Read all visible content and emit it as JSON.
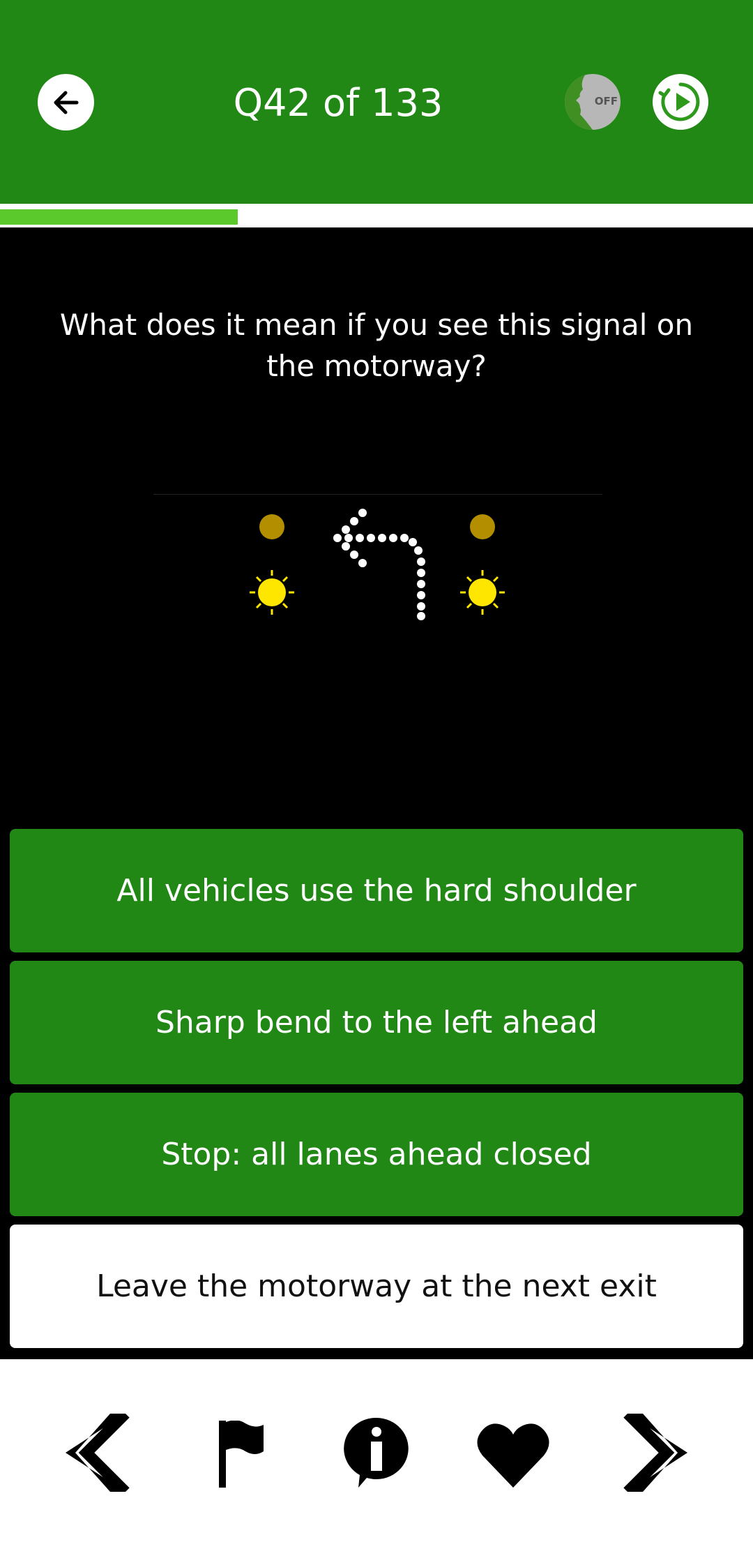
{
  "header": {
    "title": "Q42 of 133",
    "voice_state": "OFF",
    "icons": {
      "back": "arrow-left-icon",
      "voice": "voice-toggle-icon",
      "replay": "replay-icon"
    }
  },
  "progress": {
    "fraction": 0.3158,
    "color": "#5bc82b"
  },
  "question": {
    "text": "What does it mean if you see this signal on the motorway?",
    "image": "motorway-signal-left-arrow-flashing-amber"
  },
  "answers": [
    {
      "label": "All vehicles use the hard shoulder",
      "style": "green"
    },
    {
      "label": "Sharp bend to the left ahead",
      "style": "green"
    },
    {
      "label": "Stop: all lanes ahead closed",
      "style": "green"
    },
    {
      "label": "Leave the motorway at the next exit",
      "style": "white"
    }
  ],
  "bottom_nav": [
    {
      "icon": "chevron-left-icon"
    },
    {
      "icon": "flag-icon"
    },
    {
      "icon": "info-icon"
    },
    {
      "icon": "heart-icon"
    },
    {
      "icon": "chevron-right-icon"
    }
  ],
  "colors": {
    "header": "#218816",
    "answer_bg": "#218816",
    "selected_answer_bg": "#ffffff",
    "background": "#000000"
  }
}
